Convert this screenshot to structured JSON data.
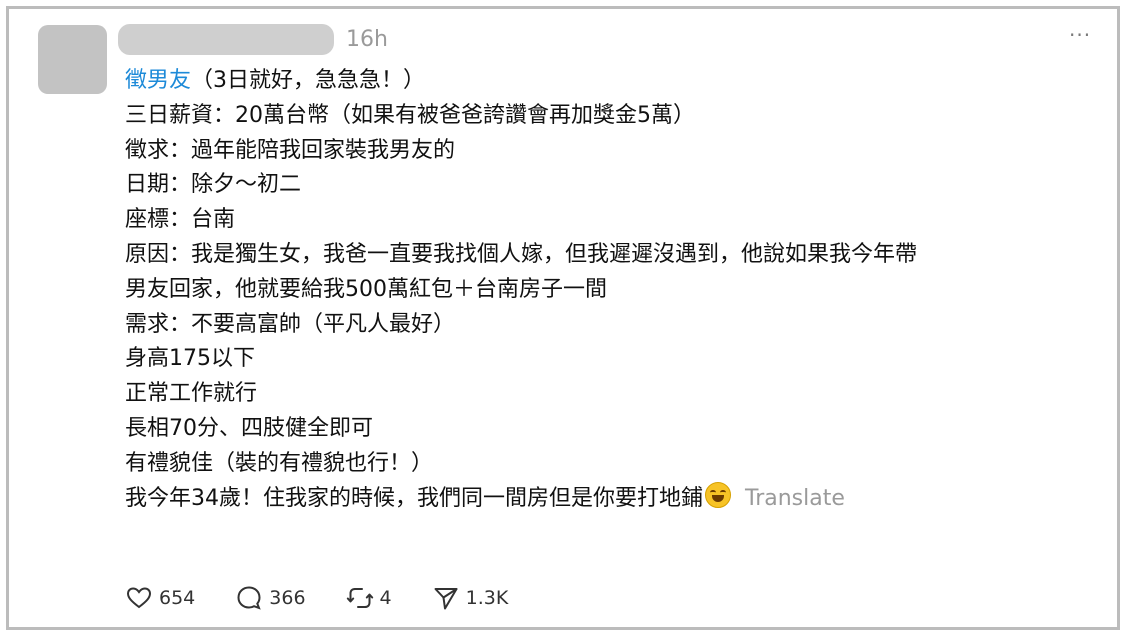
{
  "post": {
    "time": "16h",
    "more_label": "···",
    "tag": "徵男友",
    "title_rest": "（3日就好，急急急！）",
    "lines": [
      "三日薪資：20萬台幣（如果有被爸爸誇讚會再加獎金5萬）",
      "徵求：過年能陪我回家裝我男友的",
      "日期：除夕～初二",
      "座標：台南",
      "原因：我是獨生女，我爸一直要我找個人嫁，但我遲遲沒遇到，他說如果我今年帶",
      "男友回家，他就要給我500萬紅包＋台南房子一間",
      "需求：不要高富帥（平凡人最好）",
      "身高175以下",
      "正常工作就行",
      "長相70分、四肢健全即可",
      "有禮貌佳（裝的有禮貌也行！）"
    ],
    "last_line": "我今年34歲！住我家的時候，我們同一間房但是你要打地鋪",
    "emoji": "laughing-with-tears-emoji",
    "translate_label": "Translate"
  },
  "actions": {
    "likes": "654",
    "comments": "366",
    "reposts": "4",
    "shares": "1.3K"
  },
  "icons": {
    "like": "heart-icon",
    "comment": "comment-bubble-icon",
    "repost": "repost-icon",
    "share": "send-icon"
  },
  "colors": {
    "tag": "#1d8ad8",
    "muted": "#9a9a9a",
    "border": "#bcbcbc"
  }
}
